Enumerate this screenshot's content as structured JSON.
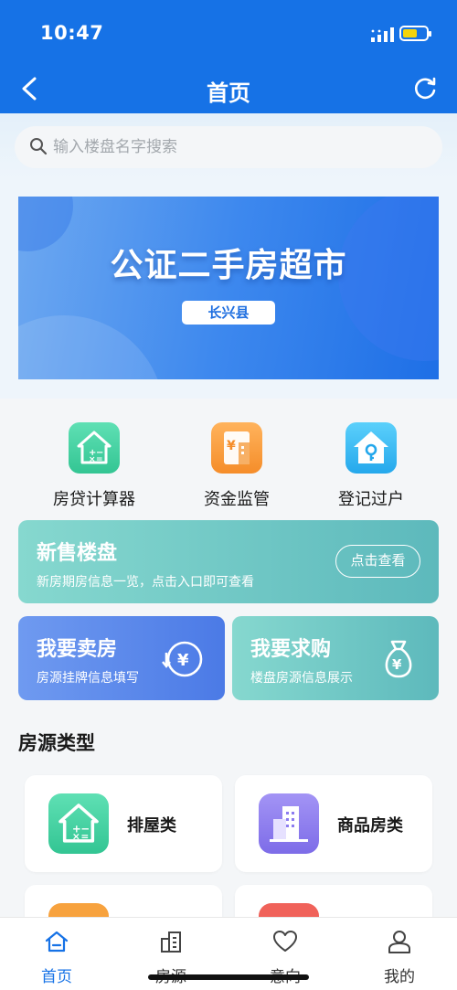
{
  "status": {
    "time": "10:47"
  },
  "nav": {
    "title": "首页"
  },
  "search": {
    "placeholder": "输入楼盘名字搜索"
  },
  "banner": {
    "title": "公证二手房超市",
    "tag": "长兴县"
  },
  "tools": [
    {
      "label": "房贷计算器",
      "icon": "house-calculator-icon"
    },
    {
      "label": "资金监管",
      "icon": "yuan-document-icon"
    },
    {
      "label": "登记过户",
      "icon": "house-key-icon"
    }
  ],
  "new_homes": {
    "title": "新售楼盘",
    "subtitle": "新房期房信息一览，点击入口即可查看",
    "button": "点击查看"
  },
  "sell": {
    "title": "我要卖房",
    "subtitle": "房源挂牌信息填写",
    "icon": "yuan-refresh-icon"
  },
  "buy": {
    "title": "我要求购",
    "subtitle": "楼盘房源信息展示",
    "icon": "money-bag-icon"
  },
  "section": {
    "title": "房源类型"
  },
  "types": [
    {
      "label": "排屋类",
      "icon": "house-calculator-icon"
    },
    {
      "label": "商品房类",
      "icon": "building-icon"
    }
  ],
  "tabs": [
    {
      "label": "首页",
      "icon": "home-icon",
      "active": true
    },
    {
      "label": "房源",
      "icon": "buildings-icon",
      "active": false
    },
    {
      "label": "意向",
      "icon": "heart-icon",
      "active": false
    },
    {
      "label": "我的",
      "icon": "user-icon",
      "active": false
    }
  ],
  "colors": {
    "primary": "#1672e6",
    "teal": "#5db9bc",
    "blue_card": "#4b7ae6",
    "orange": "#f7a23e",
    "green": "#3fd3a4",
    "sky": "#3cb8f0",
    "purple": "#8c7cf0"
  }
}
